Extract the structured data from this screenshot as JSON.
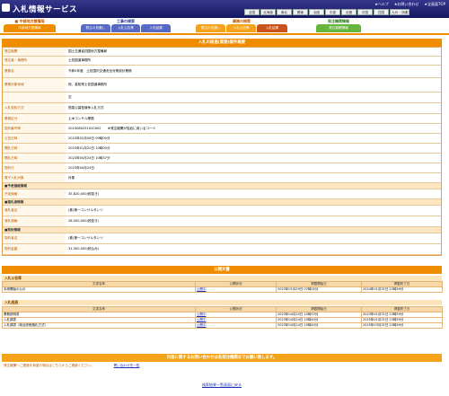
{
  "header": {
    "title": "入札情報サービス",
    "help": "★ヘルプ",
    "contact": "★お問い合わせ",
    "top": "★全画面TOP"
  },
  "regions": [
    "全国",
    "北海道",
    "東北",
    "関東",
    "北陸",
    "中部",
    "近畿",
    "中国",
    "四国",
    "九州・沖縄"
  ],
  "nav": {
    "construction": {
      "heading": "工事の検索",
      "tabs": [
        "発注の見通し",
        "入札公告等",
        "入札結果"
      ]
    },
    "service": {
      "heading": "業務の検索",
      "tabs": [
        "発注の見通し",
        "入札公告等",
        "入札結果"
      ]
    },
    "order_info": {
      "heading": "発注機関情報",
      "tabs": [
        "発注機関情報"
      ]
    },
    "left": {
      "heading": "■ 中部地方整備局",
      "tab": "中部地方整備局"
    }
  },
  "detail": {
    "heading": "入札の経過(業務)案件概要",
    "rows": [
      {
        "k": "発注機関",
        "v": "国土交通省四国地方整備局"
      },
      {
        "k": "発注者・事務所",
        "v": "土佐国道事務所"
      },
      {
        "k": "業務名",
        "v": "令和5年度　土佐国内交通安全対策設計業務"
      },
      {
        "k": "業務対象地域",
        "v": "他、高知県土佐国道事務所"
      },
      {
        "k": "",
        "v": "空"
      },
      {
        "k": "入札契約方式",
        "v": "簡易公募型競争入札方式"
      },
      {
        "k": "業務区分",
        "v": "土木コンサル業務"
      },
      {
        "k": "契約番号等",
        "v": "2023080251020002　　★発注機関が独自に用いるコード"
      },
      {
        "k": "公告日時",
        "v": "2023年02月08日 09時00分"
      },
      {
        "k": "開札日時",
        "v": "2023年01月20日 10時00分"
      },
      {
        "k": "開札日時",
        "v": "2023年04月24日 10時37分"
      },
      {
        "k": "契約日",
        "v": "2023年04月24日"
      },
      {
        "k": "電子入札対象",
        "v": "対象"
      }
    ],
    "estimate_head": "■予定価格情報",
    "estimate": {
      "k": "予定価格",
      "v": "35,820,000(税抜き)"
    },
    "winner_head": "■落札者情報",
    "winner": [
      {
        "k": "落札者名",
        "v": "(株)第一コンサルタンツ"
      },
      {
        "k": "落札価格",
        "v": "28,500,000(税抜き)"
      }
    ],
    "contract_head": "■契約情報",
    "contract": [
      {
        "k": "契約者名",
        "v": "(株)第一コンサルタンツ"
      },
      {
        "k": "契約金額",
        "v": "31,350,000(税込み)"
      }
    ]
  },
  "docs": {
    "heading": "公開文書",
    "notice_head": "入札公告等",
    "cols": [
      "文書名称",
      "公開状況",
      "掲載開始日",
      "掲載終了日"
    ],
    "notice_rows": [
      [
        "手続開始の公示",
        "公開中",
        "2023年01月29日 07時00分",
        "2024年01月31日 23時59分"
      ]
    ],
    "result_head": "入札経過",
    "result_rows": [
      [
        "業務説明書",
        "公開中",
        "2023年04月20日 10時53分",
        "2023年01月31日 23時59分"
      ],
      [
        "入札調書",
        "公開中",
        "2023年04月24日 10時40分",
        "2025年01月31日 23時59分"
      ],
      [
        "入札調書（総合評価落札方式）",
        "公開中",
        "2023年04月24日 10時40分",
        "2025年03月31日 23時59分"
      ]
    ]
  },
  "contact": {
    "heading": "内容に関するお問い合わせは各発注機関までお願い致します。",
    "text": "発注機関へご連絡を希望の場合はこちらからご連絡ください。",
    "link": "問い合わせ先一覧"
  },
  "back": "検索結果一覧画面に戻る",
  "colors": {
    "orange": "#f08c00",
    "navy": "#1c1f6a"
  }
}
